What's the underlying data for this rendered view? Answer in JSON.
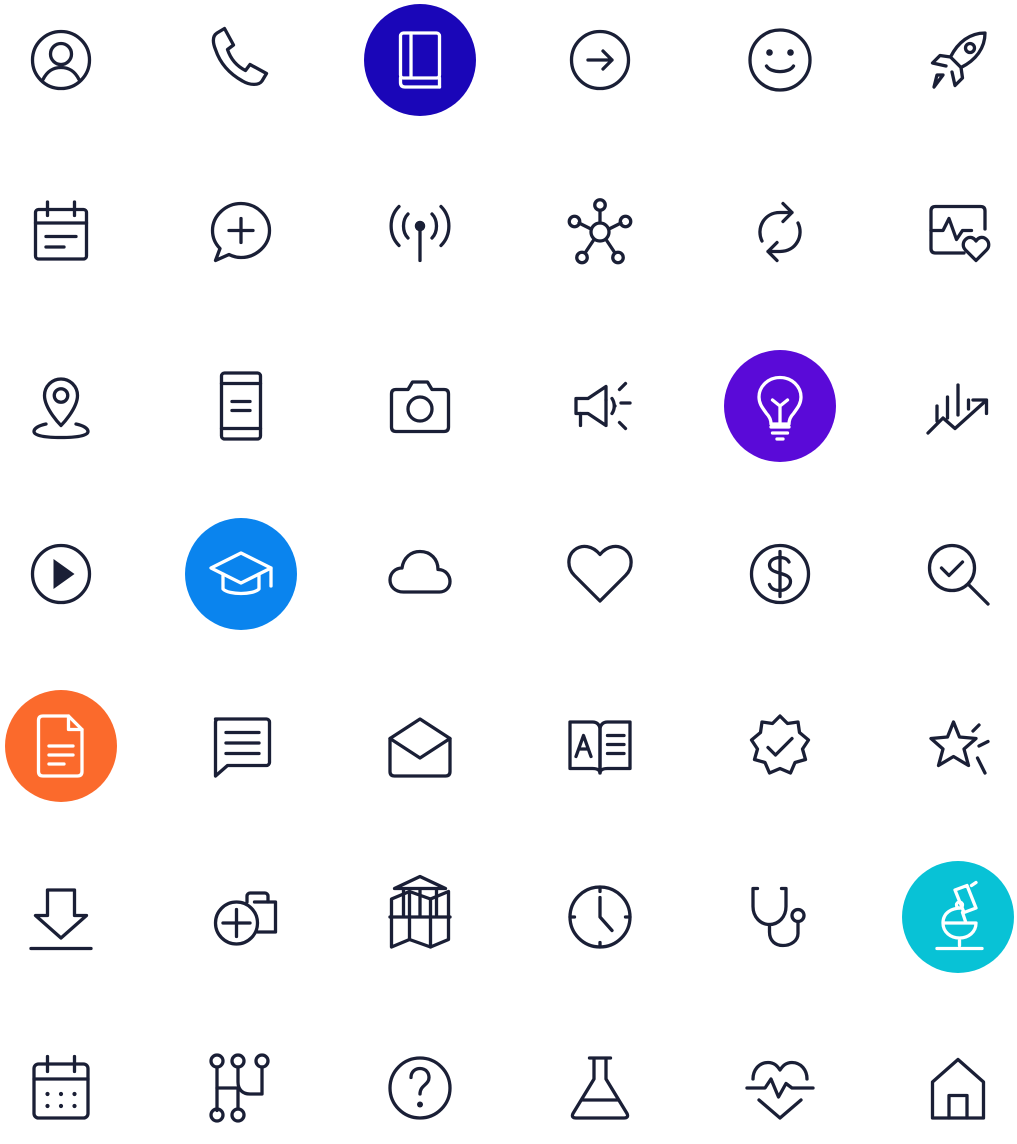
{
  "icon_grid": {
    "rows": [
      [
        {
          "icon": "user-circle-icon"
        },
        {
          "icon": "phone-icon"
        },
        {
          "icon": "book-icon",
          "bg": "#1a06b8"
        },
        {
          "icon": "arrow-right-circle-icon"
        },
        {
          "icon": "smiley-icon"
        },
        {
          "icon": "rocket-icon"
        }
      ],
      [
        {
          "icon": "calendar-notes-icon"
        },
        {
          "icon": "chat-add-icon"
        },
        {
          "icon": "broadcast-antenna-icon"
        },
        {
          "icon": "network-hub-icon"
        },
        {
          "icon": "refresh-arrows-icon"
        },
        {
          "icon": "health-monitor-heart-icon"
        }
      ],
      [
        {
          "icon": "location-pin-icon"
        },
        {
          "icon": "mobile-phone-icon"
        },
        {
          "icon": "camera-icon"
        },
        {
          "icon": "megaphone-icon"
        },
        {
          "icon": "lightbulb-icon",
          "bg": "#5a0ad8"
        },
        {
          "icon": "growth-chart-icon"
        }
      ],
      [
        {
          "icon": "play-circle-icon"
        },
        {
          "icon": "graduation-cap-icon",
          "bg": "#0a84ee"
        },
        {
          "icon": "cloud-icon"
        },
        {
          "icon": "heart-icon"
        },
        {
          "icon": "dollar-circle-icon"
        },
        {
          "icon": "search-check-icon"
        }
      ],
      [
        {
          "icon": "document-icon",
          "bg": "#fb6a2c"
        },
        {
          "icon": "message-text-icon"
        },
        {
          "icon": "mail-open-icon"
        },
        {
          "icon": "language-book-icon"
        },
        {
          "icon": "verified-badge-icon"
        },
        {
          "icon": "star-sparkle-icon"
        }
      ],
      [
        {
          "icon": "download-icon"
        },
        {
          "icon": "add-briefcase-icon"
        },
        {
          "icon": "map-institution-icon"
        },
        {
          "icon": "clock-icon"
        },
        {
          "icon": "stethoscope-icon"
        },
        {
          "icon": "microscope-icon",
          "bg": "#08c2d6"
        }
      ],
      [
        {
          "icon": "calendar-grid-icon"
        },
        {
          "icon": "workflow-nodes-icon"
        },
        {
          "icon": "question-circle-icon"
        },
        {
          "icon": "lab-flask-icon"
        },
        {
          "icon": "heartbeat-icon"
        },
        {
          "icon": "home-icon"
        }
      ]
    ]
  }
}
